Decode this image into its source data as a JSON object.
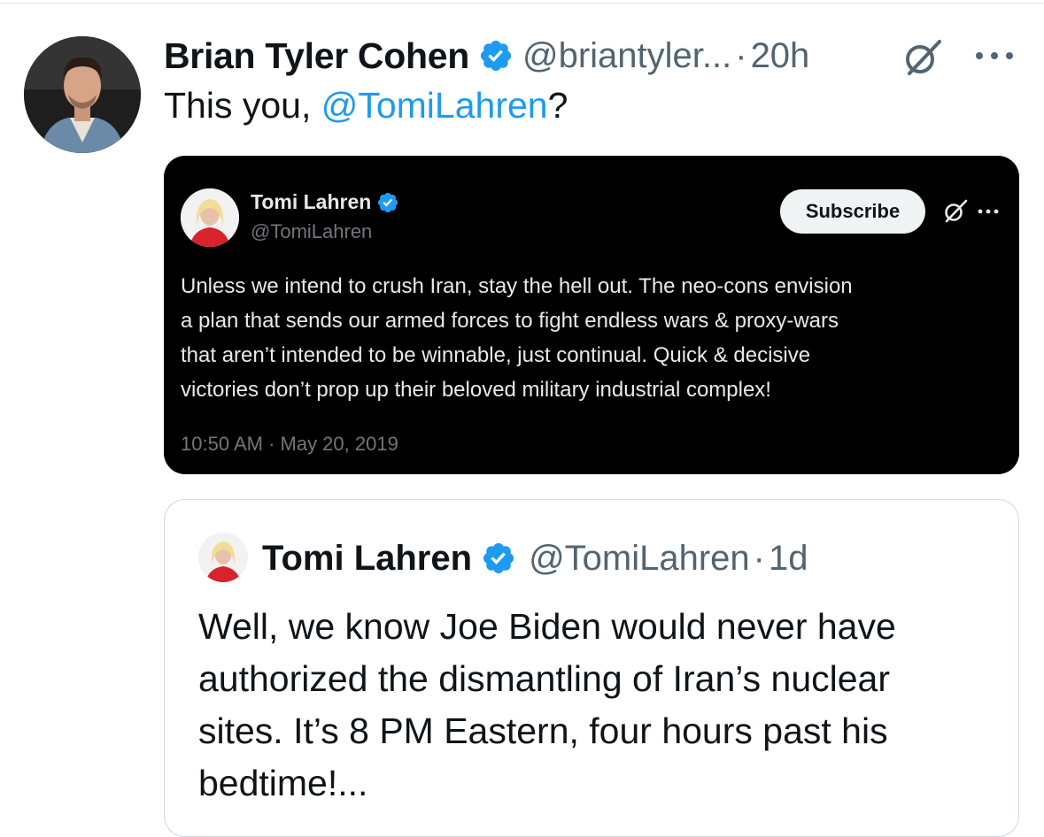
{
  "tweet": {
    "author_name": "Brian Tyler Cohen",
    "handle": "@briantyler...",
    "separator": "·",
    "time": "20h",
    "text_before": "This you, ",
    "mention": "@TomiLahren",
    "text_after": "?",
    "icons": {
      "verified": "verified-badge-icon",
      "grok": "grok-icon",
      "more": "more-options-icon"
    }
  },
  "embedded_screenshot": {
    "author_name": "Tomi Lahren",
    "handle": "@TomiLahren",
    "subscribe_label": "Subscribe",
    "body_lines": [
      "Unless we intend to crush Iran, stay the hell out. The neo-cons envision",
      "a plan that sends our armed forces to fight endless wars & proxy-wars",
      "that aren’t intended to be winnable, just continual. Quick & decisive",
      "victories don’t prop up their beloved military industrial complex!"
    ],
    "timestamp": "10:50 AM · May 20, 2019"
  },
  "quoted_tweet": {
    "author_name": "Tomi Lahren",
    "handle": "@TomiLahren",
    "separator": "·",
    "time": "1d",
    "body_lines": [
      "Well, we know Joe Biden would never have",
      "authorized the dismantling of Iran’s nuclear",
      "sites. It’s 8 PM Eastern, four hours past his",
      "bedtime!..."
    ]
  },
  "colors": {
    "accent": "#1d9bf0",
    "text_primary": "#0f1419",
    "text_secondary": "#536471",
    "border": "#cfd9de",
    "dark_bg": "#000000"
  }
}
